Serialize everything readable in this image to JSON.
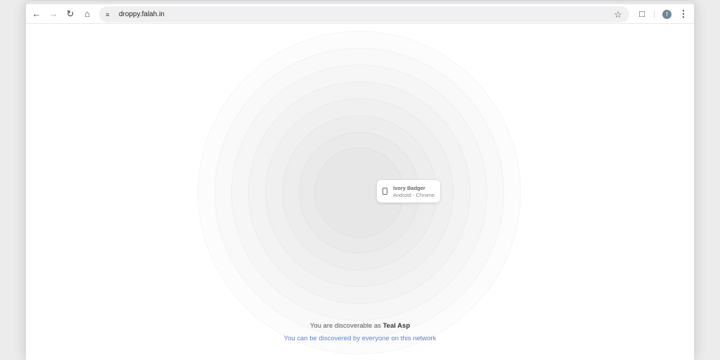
{
  "browser": {
    "url": "droppy.falah.in",
    "profile_initial": "f"
  },
  "peer": {
    "name": "Ivory Badger",
    "detail": "Android - Chrome"
  },
  "footer": {
    "prefix": "You are discoverable as",
    "self_name": "Teal Asp",
    "visibility_link": "You can be discovered by everyone on this network"
  }
}
